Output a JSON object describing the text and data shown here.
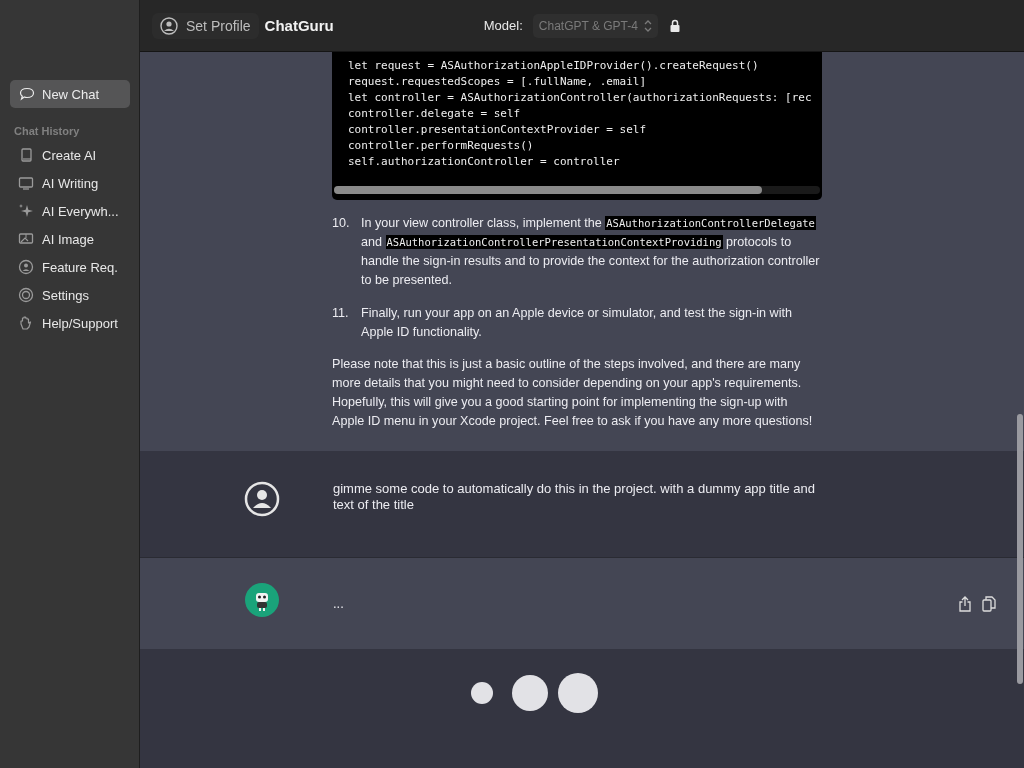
{
  "header": {
    "profile_button": "Set Profile",
    "app_title": "ChatGuru",
    "model_label": "Model:",
    "model_select": {
      "value": "ChatGPT & GPT-4",
      "disabled": true
    }
  },
  "sidebar": {
    "new_chat": {
      "label": "New Chat",
      "selected": true
    },
    "history_label": "Chat History",
    "items": [
      {
        "label": "Create AI"
      },
      {
        "label": "AI Writing"
      },
      {
        "label": "AI Everywh..."
      },
      {
        "label": "AI Image"
      },
      {
        "label": "Feature Req."
      },
      {
        "label": "Settings"
      },
      {
        "label": "Help/Support"
      }
    ]
  },
  "conversation": [
    {
      "kind": "assistant",
      "code": [
        "let request = ASAuthorizationAppleIDProvider().createRequest()",
        "request.requestedScopes = [.fullName, .email]",
        "let controller = ASAuthorizationController(authorizationRequests: [rec",
        "controller.delegate = self",
        "controller.presentationContextProvider = self",
        "controller.performRequests()",
        "self.authorizationController = controller"
      ],
      "steps": [
        {
          "number": "10.",
          "parts": [
            {
              "text": "In your view controller class, implement the "
            },
            {
              "text": "ASAuthorizationControllerDelegate",
              "code": true
            },
            {
              "text": " and "
            },
            {
              "text": "ASAuthorizationControllerPresentationContextProviding",
              "code": true
            },
            {
              "text": " protocols to handle the sign-in results and to provide the context for the authorization controller to be presented."
            }
          ]
        },
        {
          "number": "11.",
          "parts": [
            {
              "text": "Finally, run your app on an Apple device or simulator, and test the sign-in with Apple ID functionality."
            }
          ]
        }
      ],
      "paragraph": "Please note that this is just a basic outline of the steps involved, and there are many more details that you might need to consider depending on your app's requirements. Hopefully, this will give you a good starting point for implementing the sign-up with Apple ID menu in your Xcode project. Feel free to ask if you have any more questions!"
    },
    {
      "kind": "user",
      "text": "gimme some code to automatically do this in the project. with a dummy app title and text of the title"
    },
    {
      "kind": "pending",
      "text": "..."
    }
  ]
}
